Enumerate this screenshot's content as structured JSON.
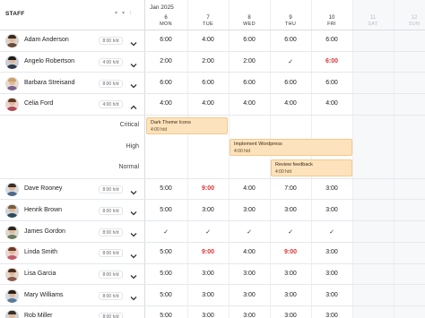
{
  "header": {
    "staff_label": "STAFF",
    "month": "Jan 2025",
    "sort_icons": [
      "arrow-down-icon",
      "arrow-down-icon",
      "arrow-up-icon"
    ],
    "days": [
      {
        "num": "6",
        "name": "MON",
        "weekend": false
      },
      {
        "num": "7",
        "name": "TUE",
        "weekend": false
      },
      {
        "num": "8",
        "name": "WED",
        "weekend": false
      },
      {
        "num": "9",
        "name": "THU",
        "weekend": false
      },
      {
        "num": "10",
        "name": "FRI",
        "weekend": false
      },
      {
        "num": "11",
        "name": "SAT",
        "weekend": true
      },
      {
        "num": "12",
        "name": "SUN",
        "weekend": true
      }
    ]
  },
  "staff": [
    {
      "name": "Adam Anderson",
      "hours": "8:00 h/d",
      "expanded": false,
      "cells": [
        {
          "v": "6:00"
        },
        {
          "v": "4:00"
        },
        {
          "v": "6:00"
        },
        {
          "v": "6:00"
        },
        {
          "v": "6:00"
        }
      ]
    },
    {
      "name": "Angelo Robertson",
      "hours": "4:00 h/d",
      "expanded": false,
      "cells": [
        {
          "v": "2:00"
        },
        {
          "v": "2:00"
        },
        {
          "v": "2:00"
        },
        {
          "v": "✓",
          "check": true
        },
        {
          "v": "6:00",
          "red": true
        }
      ]
    },
    {
      "name": "Barbara Streisand",
      "hours": "8:00 h/d",
      "expanded": false,
      "cells": [
        {
          "v": "6:00"
        },
        {
          "v": "6:00"
        },
        {
          "v": "6:00"
        },
        {
          "v": "6:00"
        },
        {
          "v": "6:00"
        }
      ]
    },
    {
      "name": "Celia Ford",
      "hours": "4:00 h/d",
      "expanded": true,
      "cells": [
        {
          "v": "4:00"
        },
        {
          "v": "4:00"
        },
        {
          "v": "4:00"
        },
        {
          "v": "4:00"
        },
        {
          "v": "4:00"
        }
      ]
    },
    {
      "name": "Dave Rooney",
      "hours": "8:00 h/d",
      "expanded": false,
      "cells": [
        {
          "v": "5:00"
        },
        {
          "v": "9:00",
          "red": true
        },
        {
          "v": "4:00"
        },
        {
          "v": "7:00"
        },
        {
          "v": "3:00"
        }
      ]
    },
    {
      "name": "Henrik Brown",
      "hours": "8:00 h/d",
      "expanded": false,
      "cells": [
        {
          "v": "5:00"
        },
        {
          "v": "3:00"
        },
        {
          "v": "3:00"
        },
        {
          "v": "3:00"
        },
        {
          "v": "3:00"
        }
      ]
    },
    {
      "name": "James Gordon",
      "hours": "8:00 h/d",
      "expanded": false,
      "cells": [
        {
          "v": "✓",
          "check": true
        },
        {
          "v": "✓",
          "check": true
        },
        {
          "v": "✓",
          "check": true
        },
        {
          "v": "✓",
          "check": true
        },
        {
          "v": "✓",
          "check": true
        }
      ]
    },
    {
      "name": "Linda Smith",
      "hours": "8:00 h/d",
      "expanded": false,
      "cells": [
        {
          "v": "5:00"
        },
        {
          "v": "9:00",
          "red": true
        },
        {
          "v": "4:00"
        },
        {
          "v": "9:00",
          "red": true
        },
        {
          "v": "3:00"
        }
      ]
    },
    {
      "name": "Lisa Garcia",
      "hours": "8:00 h/d",
      "expanded": false,
      "cells": [
        {
          "v": "5:00"
        },
        {
          "v": "3:00"
        },
        {
          "v": "3:00"
        },
        {
          "v": "3:00"
        },
        {
          "v": "3:00"
        }
      ]
    },
    {
      "name": "Mary Williams",
      "hours": "8:00 h/d",
      "expanded": false,
      "cells": [
        {
          "v": "5:00"
        },
        {
          "v": "3:00"
        },
        {
          "v": "3:00"
        },
        {
          "v": "3:00"
        },
        {
          "v": "3:00"
        }
      ]
    },
    {
      "name": "Rob Miller",
      "hours": "8:00 h/d",
      "expanded": false,
      "cells": [
        {
          "v": "5:00"
        },
        {
          "v": "3:00"
        },
        {
          "v": "3:00"
        },
        {
          "v": "3:00"
        },
        {
          "v": "3:00"
        }
      ]
    }
  ],
  "priorities": [
    "Critical",
    "High",
    "Normal"
  ],
  "tasks": [
    {
      "title": "Dark Theme Icons",
      "detail": "4:00 h/d",
      "priority": "Critical"
    },
    {
      "title": "Implement Wordpress",
      "detail": "4:00 h/d",
      "priority": "High"
    },
    {
      "title": "Review feedback",
      "detail": "4:00 h/d",
      "priority": "Normal"
    }
  ],
  "colors": {
    "red": "#e03131",
    "task_bg": "#fde3bd",
    "task_border": "#f3c98d",
    "grid": "#eceef1"
  }
}
